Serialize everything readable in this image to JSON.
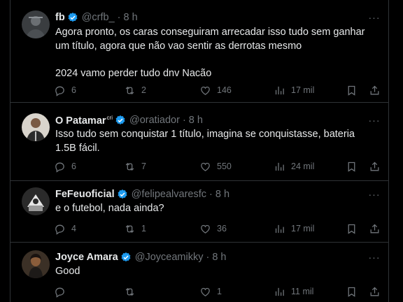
{
  "tweets": [
    {
      "name": "fb",
      "name_sup": "",
      "handle": "@crfb_",
      "time": "8 h",
      "text": "Agora pronto, os caras conseguiram arrecadar isso tudo sem ganhar um título, agora que não vao sentir as derrotas mesmo\n\n2024 vamo perder tudo dnv Nacão",
      "replies": "6",
      "retweets": "2",
      "likes": "146",
      "views": "17 mil"
    },
    {
      "name": "O Patamar",
      "name_sup": "cri",
      "handle": "@oratiador",
      "time": "8 h",
      "text": "Isso tudo sem conquistar 1 título, imagina se conquistasse, bateria 1.5B fácil.",
      "replies": "6",
      "retweets": "7",
      "likes": "550",
      "views": "24 mil"
    },
    {
      "name": "FeFeuoficial",
      "name_sup": "",
      "handle": "@felipealvaresfc",
      "time": "8 h",
      "text": "e o futebol, nada ainda?",
      "replies": "4",
      "retweets": "1",
      "likes": "36",
      "views": "17 mil"
    },
    {
      "name": "Joyce Amara",
      "name_sup": "",
      "handle": "@Joyceamikky",
      "time": "8 h",
      "text": "Good",
      "replies": "",
      "retweets": "",
      "likes": "1",
      "views": "11 mil"
    }
  ],
  "separator": "·",
  "more_glyph": "···",
  "colors": {
    "background": "#000000",
    "text": "#e7e9ea",
    "muted": "#71767b",
    "verified": "#1d9bf0",
    "border": "#2f3336"
  },
  "icons": [
    "verified-badge-icon",
    "more-icon",
    "reply-icon",
    "retweet-icon",
    "like-icon",
    "views-icon",
    "bookmark-icon",
    "share-icon"
  ]
}
